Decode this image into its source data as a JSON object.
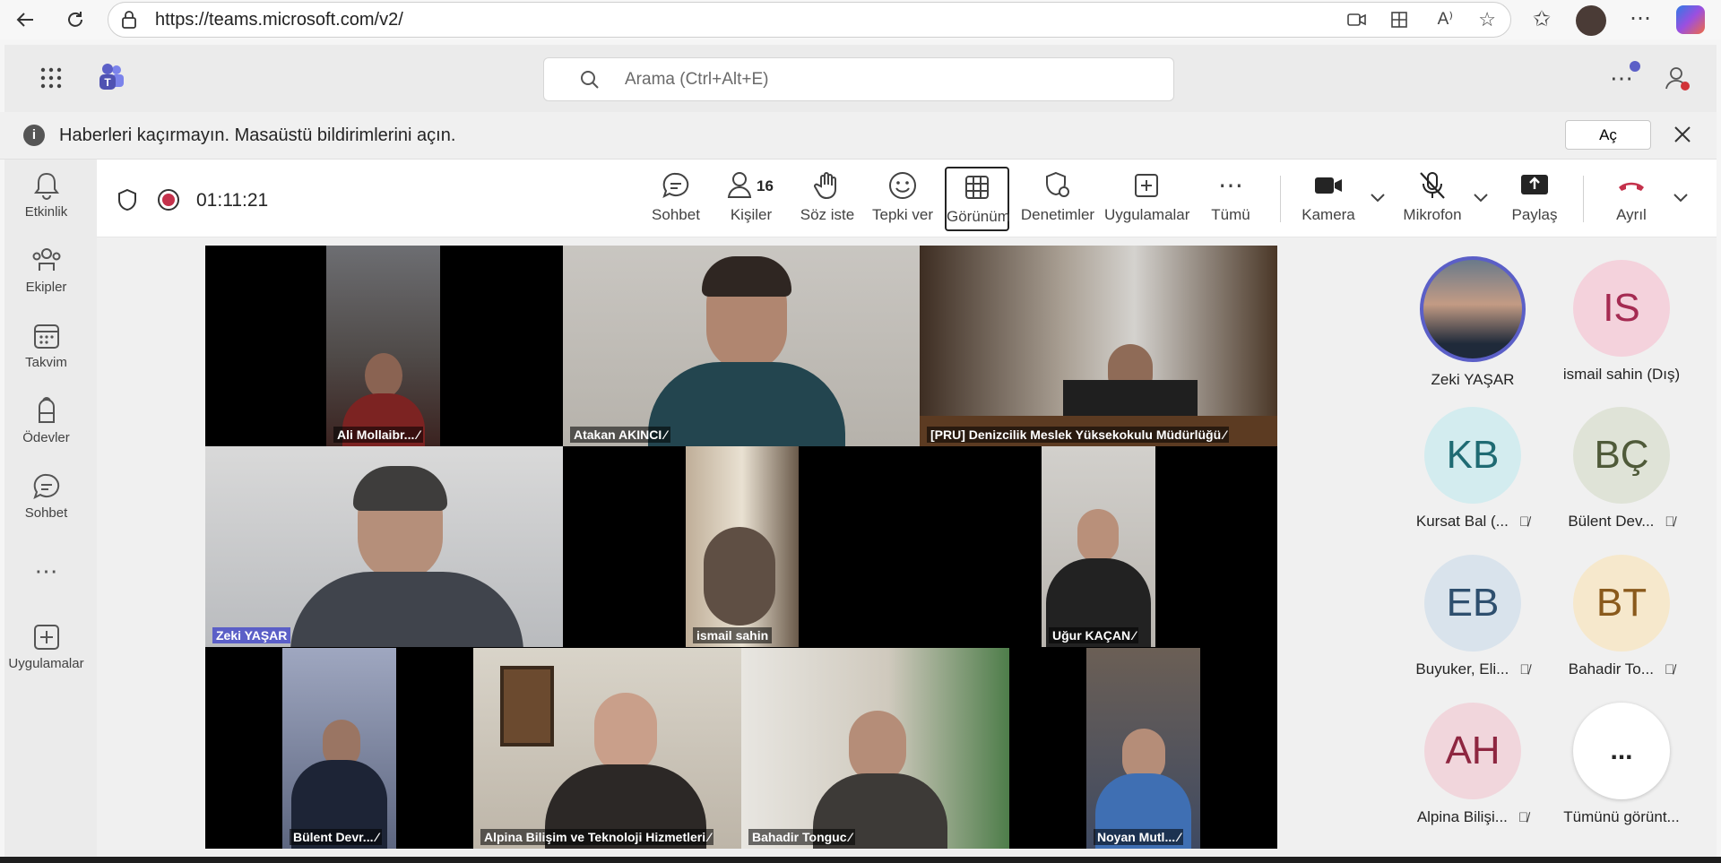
{
  "browser": {
    "url": "https://teams.microsoft.com/v2/"
  },
  "teams": {
    "search_placeholder": "Arama (Ctrl+Alt+E)",
    "notification": "Haberleri kaçırmayın. Masaüstü bildirimlerini açın.",
    "notification_button": "Aç"
  },
  "rail": [
    {
      "label": "Etkinlik",
      "icon": "bell-icon"
    },
    {
      "label": "Ekipler",
      "icon": "teams-icon"
    },
    {
      "label": "Takvim",
      "icon": "calendar-icon"
    },
    {
      "label": "Ödevler",
      "icon": "backpack-icon"
    },
    {
      "label": "Sohbet",
      "icon": "chat-icon"
    },
    {
      "label": "Uygulamalar",
      "icon": "apps-add-icon"
    }
  ],
  "meeting": {
    "timer": "01:11:21",
    "people_count": "16",
    "toolbar": {
      "chat": "Sohbet",
      "people": "Kişiler",
      "raise_hand": "Söz iste",
      "react": "Tepki ver",
      "view": "Görünüm",
      "controls": "Denetimler",
      "apps": "Uygulamalar",
      "more": "Tümü",
      "camera": "Kamera",
      "mic": "Mikrofon",
      "share": "Paylaş",
      "leave": "Ayrıl"
    }
  },
  "tiles": [
    {
      "name": "Ali Mollaibr..."
    },
    {
      "name": "Atakan AKINCI"
    },
    {
      "name": "[PRU] Denizcilik Meslek Yüksekokulu Müdürlüğü"
    },
    {
      "name": "Zeki YAŞAR"
    },
    {
      "name": "ismail sahin"
    },
    {
      "name": "Uğur KAÇAN"
    },
    {
      "name": "Bülent Devr..."
    },
    {
      "name": "Alpina Bilişim ve Teknoloji Hizmetleri"
    },
    {
      "name": "Bahadir Tonguc"
    },
    {
      "name": "Noyan Mutl..."
    }
  ],
  "roster": [
    {
      "initials": "",
      "name": "Zeki YAŞAR",
      "muted": false
    },
    {
      "initials": "IS",
      "name": "ismail sahin (Dış)",
      "muted": false
    },
    {
      "initials": "KB",
      "name": "Kursat Bal (...",
      "muted": true
    },
    {
      "initials": "BÇ",
      "name": "Bülent Dev...",
      "muted": true
    },
    {
      "initials": "EB",
      "name": "Buyuker, Eli...",
      "muted": true
    },
    {
      "initials": "BT",
      "name": "Bahadir To...",
      "muted": true
    },
    {
      "initials": "AH",
      "name": "Alpina Bilişi...",
      "muted": true
    },
    {
      "initials": "...",
      "name": "Tümünü görünt...",
      "muted": false
    }
  ],
  "colors": {
    "brand": "#5b5fc7",
    "record": "#c4314b",
    "leave": "#c4314b"
  }
}
